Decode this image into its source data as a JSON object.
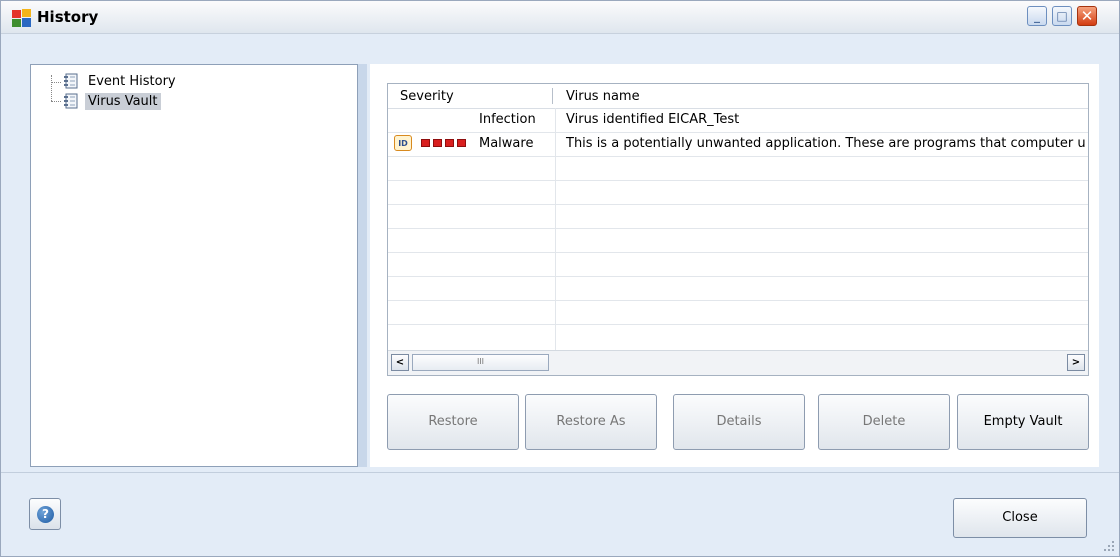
{
  "window": {
    "title": "History",
    "controls": {
      "minimize": "_",
      "maximize": "□",
      "close": "✕"
    }
  },
  "tree": {
    "items": [
      {
        "label": "Event History",
        "selected": false,
        "icon": "document-list-icon"
      },
      {
        "label": "Virus Vault",
        "selected": true,
        "icon": "document-list-icon"
      }
    ]
  },
  "grid": {
    "columns": [
      "Severity",
      "Virus name"
    ],
    "rows": [
      {
        "severity": "Infection",
        "name": "Virus identified EICAR_Test",
        "icon": "",
        "squares": 0
      },
      {
        "severity": "Malware",
        "name": "This is a potentially unwanted application. These are programs that computer u",
        "icon": "ID",
        "squares": 4
      }
    ],
    "empty_rows": 9,
    "scroll": {
      "left": "<",
      "right": ">",
      "thumb": "III"
    }
  },
  "buttons": {
    "restore": "Restore",
    "restore_as": "Restore As",
    "details": "Details",
    "delete": "Delete",
    "empty_vault": "Empty Vault",
    "close": "Close",
    "help": "?"
  },
  "colors": {
    "severity_red": "#d91f1f",
    "selection": "#c9ced6"
  }
}
